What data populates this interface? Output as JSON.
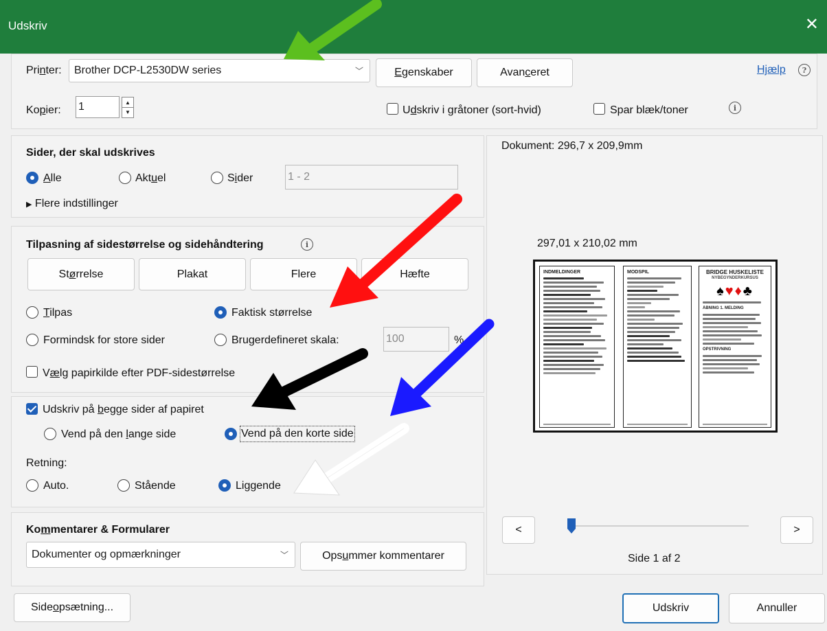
{
  "window": {
    "title": "Udskriv"
  },
  "printer": {
    "label_pre": "Pri",
    "label_ul": "n",
    "label_post": "ter:",
    "selected": "Brother DCP-L2530DW series",
    "properties_pre": "",
    "properties_ul": "E",
    "properties_post": "genskaber",
    "advanced_pre": "Avan",
    "advanced_ul": "c",
    "advanced_post": "eret",
    "help": "Hjælp",
    "copies_pre": "Ko",
    "copies_ul": "p",
    "copies_post": "ier:",
    "copies_value": "1",
    "grayscale_pre": "U",
    "grayscale_ul": "d",
    "grayscale_post": "skriv i gråtoner (sort-hvid)",
    "save_ink": "Spar blæk/toner"
  },
  "pages": {
    "heading": "Sider, der skal udskrives",
    "all_ul": "A",
    "all_post": "lle",
    "current_pre": "Akt",
    "current_ul": "u",
    "current_post": "el",
    "pages_pre": "S",
    "pages_ul": "i",
    "pages_post": "der",
    "range_placeholder": "1 - 2",
    "more_settings": "Flere indstillinger"
  },
  "sizing": {
    "heading": "Tilpasning af sidestørrelse og sidehåndtering",
    "btn_size_pre": "St",
    "btn_size_ul": "ø",
    "btn_size_post": "rrelse",
    "btn_poster": "Plakat",
    "btn_multiple": "Flere",
    "btn_booklet": "Hæfte",
    "fit_ul": "T",
    "fit_post": "ilpas",
    "actual_size": "Faktisk størrelse",
    "shrink": "Formindsk for store sider",
    "custom_scale": "Brugerdefineret skala:",
    "scale_value": "100",
    "percent": "%",
    "paper_source_pre": "V",
    "paper_source_ul": "æ",
    "paper_source_post": "lg papirkilde efter PDF-sidestørrelse"
  },
  "duplex": {
    "both_sides_pre": "Udskriv på ",
    "both_sides_ul": "b",
    "both_sides_post": "egge sider af papiret",
    "long_edge_pre": "Vend på den ",
    "long_edge_ul": "l",
    "long_edge_post": "ange side",
    "short_edge": "Vend på den korte side",
    "orientation_label": "Retning:",
    "auto": "Auto.",
    "portrait": "Stående",
    "landscape": "Liggende"
  },
  "comments": {
    "heading_pre": "Ko",
    "heading_ul": "m",
    "heading_post": "mentarer & Formularer",
    "selected": "Dokumenter og opmærkninger",
    "summarize_pre": "Ops",
    "summarize_ul": "u",
    "summarize_post": "mmer kommentarer"
  },
  "preview": {
    "document_size": "Dokument: 296,7 x 209,9mm",
    "page_size": "297,01 x 210,02 mm",
    "page_indicator": "Side 1 af 2",
    "prev": "<",
    "next": ">",
    "sheet_title": "BRIDGE HUSKELISTE",
    "sheet_subtitle": "NYBEGYNDERKURSUS",
    "suits": "♠♥♦♣",
    "col1_title": "INDMELDINGER",
    "col2_title": "MODSPIL",
    "col3_section": "ÅBNING 1. MELDING",
    "col3_section2": "OPSTRIVNING"
  },
  "footer": {
    "page_setup_pre": "Side",
    "page_setup_ul": "o",
    "page_setup_post": "psætning...",
    "print": "Udskriv",
    "cancel": "Annuller"
  },
  "colors": {
    "titlebar": "#1f7e3c",
    "accent": "#1f5fb8",
    "arrow_green": "#5cbf1f",
    "arrow_red": "#ff1010",
    "arrow_black": "#000000",
    "arrow_blue": "#1a1aff",
    "arrow_white": "#ffffff"
  },
  "icons": [
    "close-icon",
    "chevron-down-icon",
    "help-icon",
    "info-icon",
    "triangle-right-icon",
    "spin-up-icon",
    "spin-down-icon"
  ]
}
